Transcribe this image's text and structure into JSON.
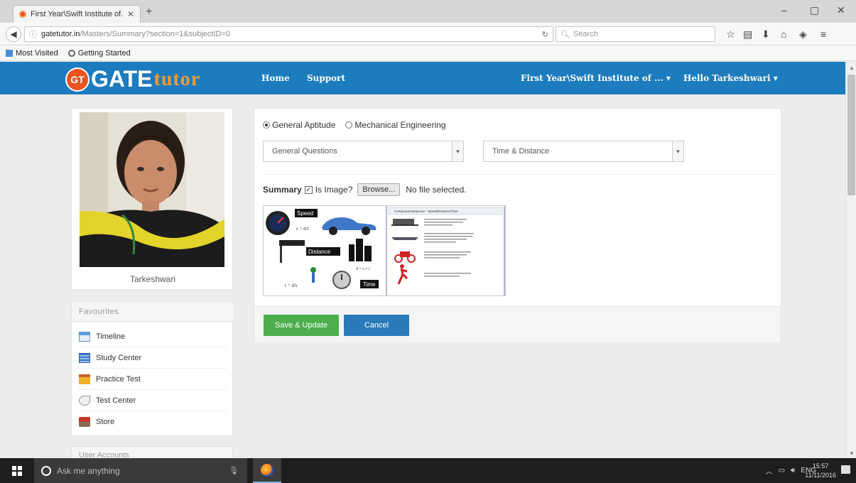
{
  "browser": {
    "tab_title": "First Year\\Swift Institute of...",
    "tab_close": "✕",
    "new_tab": "+",
    "url_host": "gatetutor.in",
    "url_path": "/Masters/Summary?section=1&subjectID=0",
    "search_placeholder": "Search",
    "bookmarks": [
      "Most Visited",
      "Getting Started"
    ]
  },
  "header": {
    "logo_badge": "GT",
    "logo_gate": "GATE",
    "logo_tutor": "tutor",
    "nav_home": "Home",
    "nav_support": "Support",
    "institute_menu": "First Year\\Swift Institute of ... ▾",
    "user_menu": "Hello Tarkeshwari ▾"
  },
  "profile": {
    "name": "Tarkeshwari"
  },
  "favourites": {
    "title": "Favourites",
    "items": [
      {
        "label": "Timeline",
        "icon": "timeline-icon"
      },
      {
        "label": "Study Center",
        "icon": "study-center-icon"
      },
      {
        "label": "Practice Test",
        "icon": "practice-test-icon"
      },
      {
        "label": "Test Center",
        "icon": "test-center-icon"
      },
      {
        "label": "Store",
        "icon": "store-icon"
      }
    ]
  },
  "user_accounts": {
    "title": "User Accounts"
  },
  "form": {
    "radio_1": "General Aptitude",
    "radio_2": "Mechanical Engineering",
    "radio_selected": "General Aptitude",
    "select_1": "General Questions",
    "select_2": "Time & Distance",
    "summary_label": "Summary",
    "is_image_label": "Is Image?",
    "is_image_checked": true,
    "browse_label": "Browse...",
    "file_status": "No file selected.",
    "preview_words": {
      "speed": "Speed",
      "distance": "Distance",
      "time": "Time",
      "header": "Compound Measures - Speed/Distance/Time"
    },
    "save_label": "Save & Update",
    "cancel_label": "Cancel"
  },
  "taskbar": {
    "search_placeholder": "Ask me anything",
    "language": "ENG",
    "time": "15:57",
    "date": "11/11/2016"
  },
  "colors": {
    "header_bg": "#1c7cbe",
    "save_btn": "#4cae4c",
    "cancel_btn": "#2a7ab8",
    "logo_orange": "#f49a34"
  }
}
